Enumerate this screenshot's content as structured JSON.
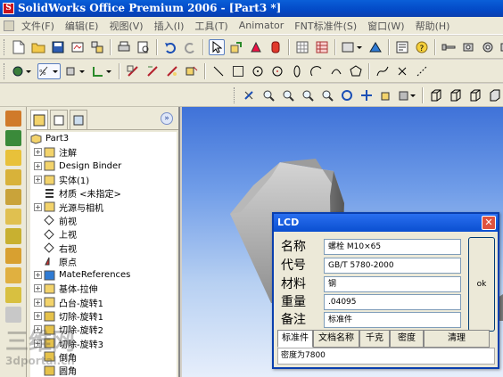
{
  "window": {
    "title": "SolidWorks Office Premium 2006 - [Part3 *]"
  },
  "menubar": {
    "items": [
      "文件(F)",
      "编辑(E)",
      "视图(V)",
      "插入(I)",
      "工具(T)",
      "Animator",
      "FNT标准件(S)",
      "窗口(W)",
      "帮助(H)"
    ]
  },
  "tree": {
    "root": "Part3",
    "items": [
      {
        "label": "注解",
        "icon": "annotations-icon",
        "expand": true
      },
      {
        "label": "Design Binder",
        "icon": "design-binder-icon",
        "expand": true
      },
      {
        "label": "实体(1)",
        "icon": "solid-bodies-icon",
        "expand": true
      },
      {
        "label": "材质 <未指定>",
        "icon": "material-icon",
        "expand": false
      },
      {
        "label": "光源与相机",
        "icon": "lights-cameras-icon",
        "expand": true
      },
      {
        "label": "前视",
        "icon": "plane-icon",
        "expand": false
      },
      {
        "label": "上视",
        "icon": "plane-icon",
        "expand": false
      },
      {
        "label": "右视",
        "icon": "plane-icon",
        "expand": false
      },
      {
        "label": "原点",
        "icon": "origin-icon",
        "expand": false
      },
      {
        "label": "MateReferences",
        "icon": "mate-references-icon",
        "expand": true
      },
      {
        "label": "基体-拉伸",
        "icon": "extrude-feature-icon",
        "expand": true
      },
      {
        "label": "凸台-旋转1",
        "icon": "revolve-feature-icon",
        "expand": true
      },
      {
        "label": "切除-旋转1",
        "icon": "cut-revolve-icon",
        "expand": true
      },
      {
        "label": "切除-旋转2",
        "icon": "cut-revolve-icon",
        "expand": true
      },
      {
        "label": "切除-旋转3",
        "icon": "cut-revolve-icon",
        "expand": true
      },
      {
        "label": "倒角",
        "icon": "chamfer-icon",
        "expand": false
      },
      {
        "label": "圆角",
        "icon": "fillet-icon",
        "expand": false
      }
    ]
  },
  "dialog": {
    "title": "LCD",
    "close": "✕",
    "fields": [
      {
        "label": "名称",
        "value": "螺栓 M10×65"
      },
      {
        "label": "代号",
        "value": "GB/T 5780-2000"
      },
      {
        "label": "材料",
        "value": "钢"
      },
      {
        "label": "重量",
        "value": ".04095"
      },
      {
        "label": "备注",
        "value": "标准件"
      }
    ],
    "ok_label": "ok",
    "tabs": [
      "标准件",
      "文档名称",
      "千克",
      "密度",
      "清理"
    ],
    "status": "密度为7800"
  },
  "panel": {
    "collapse": "»"
  },
  "watermark": {
    "line1": "三维网",
    "line2": "3dportal.cn"
  },
  "colors": {
    "titlebar": "#0349c6",
    "viewport_top": "#3f72d8",
    "viewport_bottom": "#e6eefb",
    "dialog_title": "#2a6ff0"
  }
}
